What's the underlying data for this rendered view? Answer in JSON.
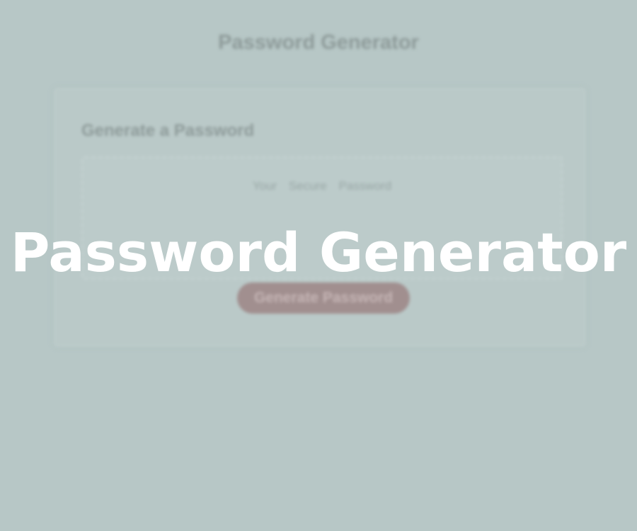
{
  "app": {
    "title": "Password Generator"
  },
  "card": {
    "header": "Generate a Password",
    "password_placeholder": "Your Secure Password",
    "generate_label": "Generate Password"
  },
  "overlay": {
    "title": "Password Generator"
  },
  "colors": {
    "background": "#b7c7c6",
    "button": "#a18f8f",
    "overlay_text": "#ffffff"
  }
}
